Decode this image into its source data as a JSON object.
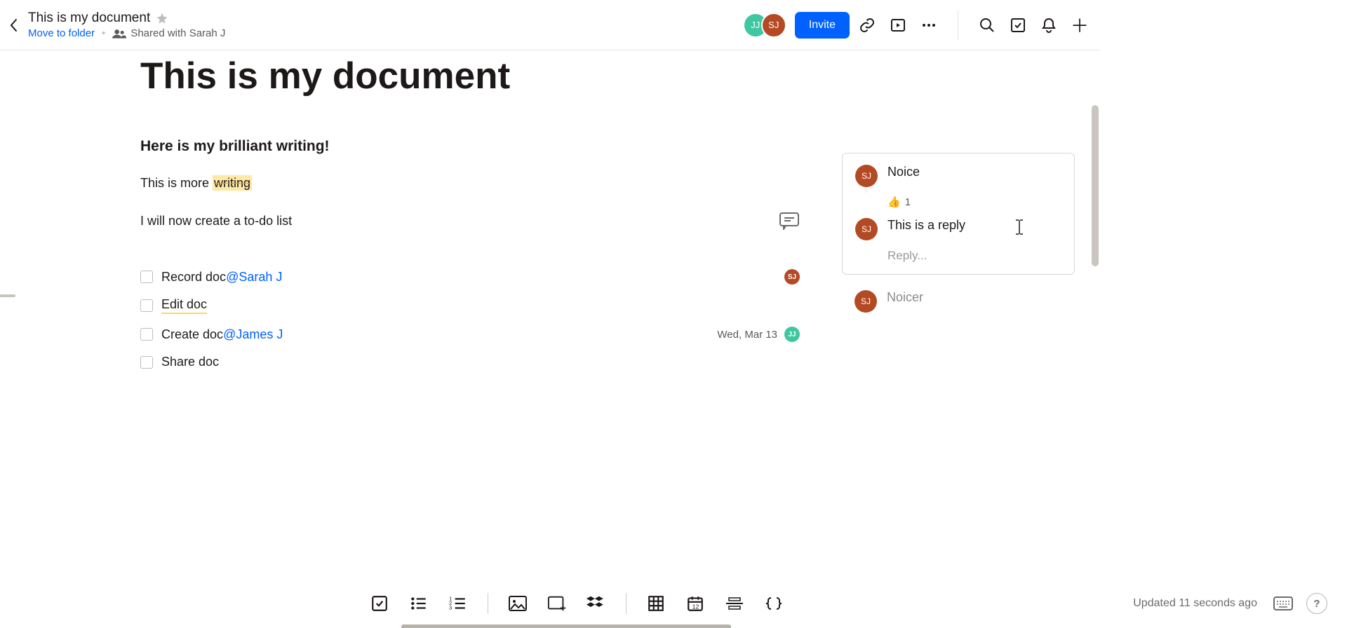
{
  "header": {
    "title": "This is my document",
    "move_link": "Move to folder",
    "shared_with": "Shared with Sarah J",
    "invite_label": "Invite",
    "avatars": [
      "JJ",
      "SJ"
    ]
  },
  "document": {
    "h1": "This is my document",
    "h3": "Here is my brilliant writing!",
    "para1_pre": "This is more ",
    "para1_hl": "writing",
    "para2": "I will now create a to-do list",
    "todos": [
      {
        "text": "Record doc ",
        "mention": "@Sarah J",
        "right_avatar": "SJ"
      },
      {
        "text": "Edit doc"
      },
      {
        "text": "Create doc ",
        "mention": "@James J",
        "date": "Wed, Mar 13",
        "right_avatar": "JJ"
      },
      {
        "text": "Share doc"
      }
    ]
  },
  "comments": {
    "thread": [
      {
        "author": "SJ",
        "body": "Noice"
      },
      {
        "author": "SJ",
        "body": "This is a reply"
      }
    ],
    "reaction_emoji": "👍",
    "reaction_count": "1",
    "reply_placeholder": "Reply...",
    "below": {
      "author": "SJ",
      "body": "Noicer"
    }
  },
  "footer": {
    "updated": "Updated 11 seconds ago",
    "help": "?"
  }
}
